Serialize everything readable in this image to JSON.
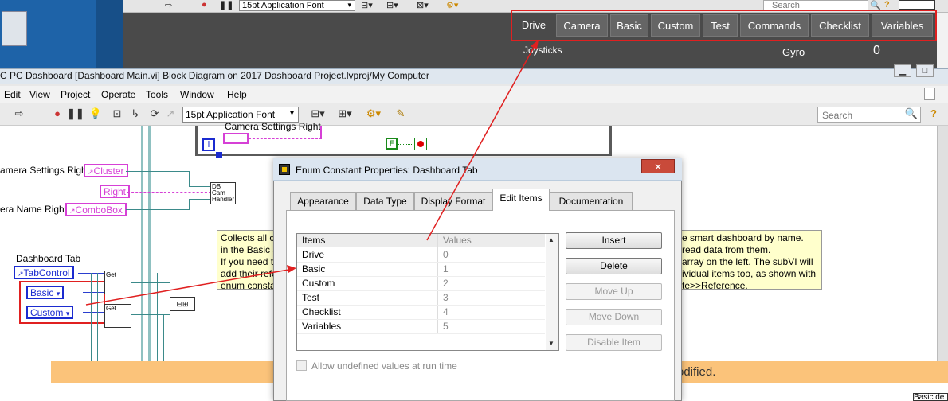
{
  "front_panel": {
    "font_select": "15pt Application Font",
    "search_placeholder": "Search",
    "tabs": [
      "Drive",
      "Camera",
      "Basic",
      "Custom",
      "Test",
      "Commands",
      "Checklist",
      "Variables"
    ],
    "active_tab": "Drive",
    "joysticks_label": "Joysticks",
    "gyro_label": "Gyro",
    "gyro_value": "0"
  },
  "block_diagram": {
    "window_title": "C PC Dashboard [Dashboard Main.vi] Block Diagram on 2017 Dashboard Project.lvproj/My Computer",
    "menu": [
      "Edit",
      "View",
      "Project",
      "Operate",
      "Tools",
      "Window",
      "Help"
    ],
    "font_select": "15pt Application Font",
    "search_placeholder": "Search",
    "labels": {
      "camera_settings_right_top": "Camera Settings Right",
      "camera_settings_right": "amera Settings Right",
      "camera_name_right": "era Name Right",
      "dashboard_tab": "Dashboard Tab"
    },
    "terminals": {
      "cluster": "Cluster",
      "right": "Right",
      "combobox": "ComboBox",
      "tabcontrol": "TabControl",
      "basic": "Basic",
      "custom": "Custom"
    },
    "subvi": {
      "db_cam_handler": "DB Cam Handler",
      "get": "Get"
    },
    "comment_lines": [
      "Collects all c",
      "in the Basic a",
      "If you need t",
      "add their refe",
      "enum consta"
    ],
    "comment_right_lines": [
      "e smart dashboard by name.",
      "read data from them.",
      "array on the left. The subVI will",
      "ividual items too, as shown with",
      "te>>Reference."
    ],
    "orange_text": "odified.",
    "corner_label": "Basic de"
  },
  "dialog": {
    "title": "Enum Constant Properties: Dashboard Tab",
    "tabs": [
      "Appearance",
      "Data Type",
      "Display Format",
      "Edit Items",
      "Documentation"
    ],
    "active_tab": "Edit Items",
    "columns": [
      "Items",
      "Values"
    ],
    "rows": [
      {
        "item": "Drive",
        "value": "0"
      },
      {
        "item": "Basic",
        "value": "1"
      },
      {
        "item": "Custom",
        "value": "2"
      },
      {
        "item": "Test",
        "value": "3"
      },
      {
        "item": "Checklist",
        "value": "4"
      },
      {
        "item": "Variables",
        "value": "5"
      }
    ],
    "buttons": {
      "insert": "Insert",
      "delete": "Delete",
      "move_up": "Move Up",
      "move_down": "Move Down",
      "disable_item": "Disable Item"
    },
    "checkbox_label": "Allow undefined values at run time"
  }
}
